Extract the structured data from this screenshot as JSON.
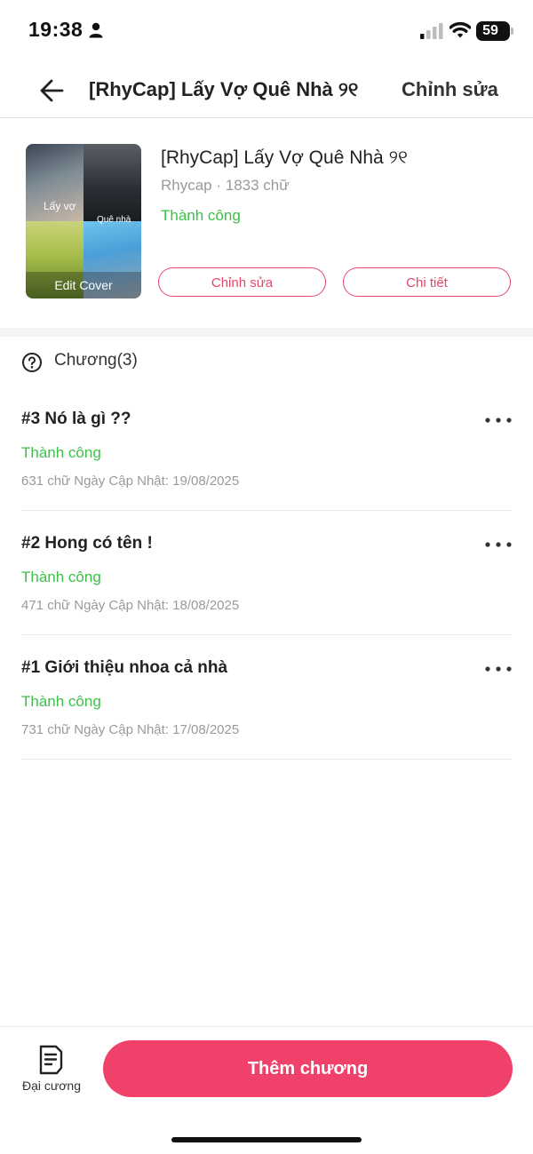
{
  "status_bar": {
    "time": "19:38",
    "battery": "59"
  },
  "nav": {
    "title": "[RhyCap] Lấy Vợ Quê Nhà ୨୧",
    "edit_label": "Chỉnh sửa"
  },
  "story": {
    "cover_label_a": "Lấy vợ",
    "cover_label_b": "Quê nhà",
    "cover_edit": "Edit Cover",
    "title": "[RhyCap] Lấy Vợ Quê Nhà ୨୧",
    "meta": "Rhycap · 1833 chữ",
    "status": "Thành công",
    "edit_button": "Chỉnh sửa",
    "detail_button": "Chi tiết"
  },
  "chapters": {
    "heading": "Chương(3)",
    "items": [
      {
        "title": "#3 Nó là gì ??",
        "status": "Thành công",
        "meta": "631 chữ Ngày Cập Nhật: 19/08/2025"
      },
      {
        "title": "#2 Hong có tên !",
        "status": "Thành công",
        "meta": "471 chữ Ngày Cập Nhật: 18/08/2025"
      },
      {
        "title": "#1 Giới thiệu nhoa cả nhà",
        "status": "Thành công",
        "meta": "731 chữ Ngày Cập Nhật: 17/08/2025"
      }
    ]
  },
  "bottom": {
    "outline_label": "Đại cương",
    "add_chapter": "Thêm chương"
  },
  "colors": {
    "accent": "#f0416a",
    "success": "#3cc047",
    "muted": "#9a9a9a"
  },
  "icons": [
    "person-icon",
    "signal-icon",
    "wifi-icon",
    "battery-icon",
    "back-arrow-icon",
    "cover-image",
    "help-icon",
    "more-icon",
    "outline-icon"
  ]
}
